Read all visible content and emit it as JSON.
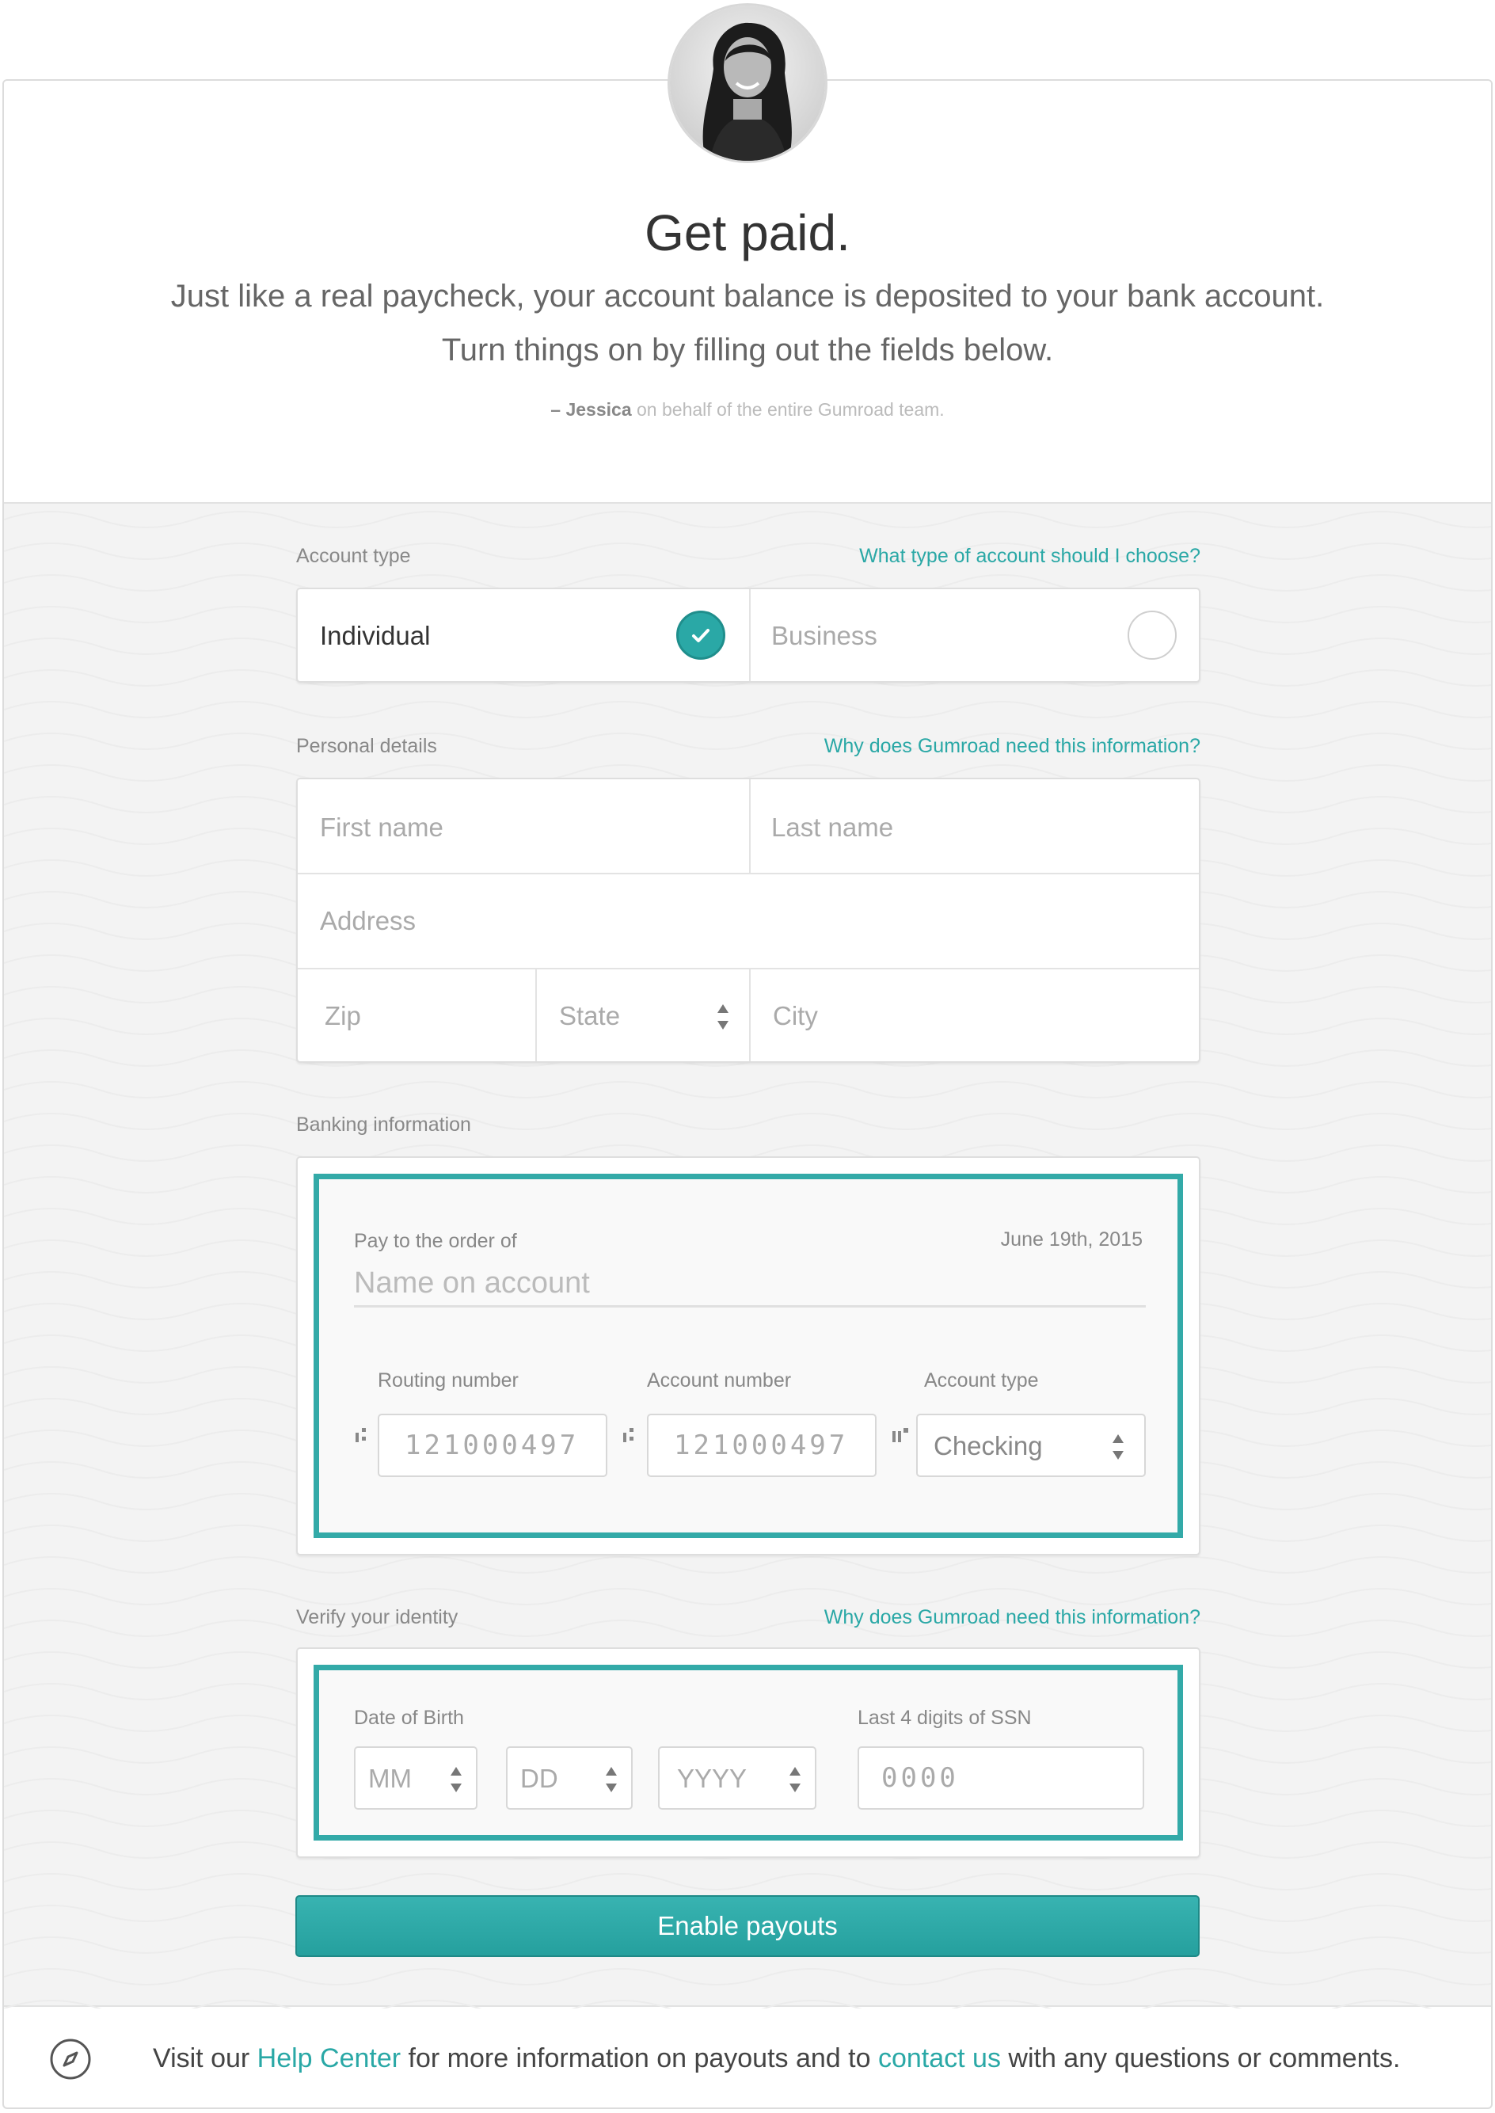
{
  "hero": {
    "title": "Get paid.",
    "subtitle_line1": "Just like a real paycheck, your account balance is deposited to your bank account.",
    "subtitle_line2": "Turn things on by filling out the fields below.",
    "signature_name": "– Jessica",
    "signature_rest": " on behalf of the entire Gumroad team."
  },
  "account_type": {
    "label": "Account type",
    "help_link": "What type of account should I choose?",
    "options": [
      {
        "label": "Individual",
        "selected": true
      },
      {
        "label": "Business",
        "selected": false
      }
    ]
  },
  "personal": {
    "label": "Personal details",
    "help_link": "Why does Gumroad need this information?",
    "first_name_placeholder": "First name",
    "last_name_placeholder": "Last name",
    "address_placeholder": "Address",
    "zip_placeholder": "Zip",
    "state_placeholder": "State",
    "city_placeholder": "City"
  },
  "banking": {
    "label": "Banking information",
    "pay_to_label": "Pay to the order of",
    "date": "June 19th, 2015",
    "name_placeholder": "Name on account",
    "routing_label": "Routing number",
    "routing_placeholder": "121000497",
    "account_number_label": "Account number",
    "account_number_placeholder": "121000497",
    "account_type_label": "Account type",
    "account_type_value": "Checking"
  },
  "identity": {
    "label": "Verify your identity",
    "help_link": "Why does Gumroad need this information?",
    "dob_label": "Date of Birth",
    "mm": "MM",
    "dd": "DD",
    "yyyy": "YYYY",
    "ssn_label": "Last 4 digits of SSN",
    "ssn_placeholder": "0000"
  },
  "submit_label": "Enable payouts",
  "footer": {
    "pre": "Visit our ",
    "help_center": "Help Center",
    "mid": " for more information on payouts and to ",
    "contact": "contact us",
    "post": " with any questions or comments."
  },
  "colors": {
    "accent": "#2aa8a6",
    "cheque_border": "#33aaa8"
  },
  "icons": [
    "check-icon",
    "sort-arrows-icon",
    "compass-icon",
    "micr-transit-icon",
    "micr-onus-icon"
  ]
}
